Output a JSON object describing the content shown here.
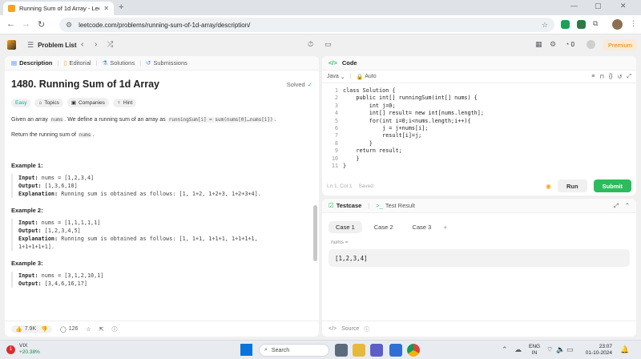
{
  "browser": {
    "tab_title": "Running Sum of 1d Array - Leet",
    "url": "leetcode.com/problems/running-sum-of-1d-array/description/"
  },
  "header": {
    "problem_list": "Problem List",
    "notif_count": "0",
    "premium": "Premium"
  },
  "left": {
    "tabs": [
      "Description",
      "Editorial",
      "Solutions",
      "Submissions"
    ],
    "title": "1480. Running Sum of 1d Array",
    "solved": "Solved",
    "tags": [
      "Easy",
      "Topics",
      "Companies",
      "Hint"
    ],
    "desc1_a": "Given an array ",
    "desc1_code1": "nums",
    "desc1_b": ". We define a running sum of an array as ",
    "desc1_code2": "runningSum[i] = sum(nums[0]…nums[i])",
    "desc1_c": ".",
    "desc2_a": "Return the running sum of ",
    "desc2_code": "nums",
    "desc2_b": ".",
    "examples": [
      {
        "title": "Example 1:",
        "input": "nums = [1,2,3,4]",
        "output": "[1,3,6,10]",
        "explanation": "Running sum is obtained as follows: [1, 1+2, 1+2+3, 1+2+3+4].",
        "explanation2": ""
      },
      {
        "title": "Example 2:",
        "input": "nums = [1,1,1,1,1]",
        "output": "[1,2,3,4,5]",
        "explanation": "Running sum is obtained as follows: [1, 1+1, 1+1+1, 1+1+1+1,",
        "explanation2": "1+1+1+1+1]."
      },
      {
        "title": "Example 3:",
        "input": "nums = [3,1,2,10,1]",
        "output": "[3,4,6,16,17]",
        "explanation": "",
        "explanation2": ""
      }
    ],
    "label_input": "Input:",
    "label_output": "Output:",
    "label_explanation": "Explanation:",
    "likes": "7.9K",
    "comments": "126"
  },
  "code": {
    "title": "Code",
    "language": "Java",
    "auto": "Auto",
    "lines": [
      "class Solution {",
      "    public int[] runningSum(int[] nums) {",
      "        int j=0;",
      "        int[] result= new int[nums.length];",
      "        for(int i=0;i<nums.length;i++){",
      "            j = j+nums[i];",
      "            result[i]=j;",
      "        }",
      "    return result;",
      "    }",
      "}"
    ],
    "line_numbers": [
      "1",
      "2",
      "3",
      "4",
      "5",
      "6",
      "7",
      "8",
      "9",
      "10",
      "11"
    ],
    "status": "Ln 1, Col 1",
    "saved": "Saved",
    "run": "Run",
    "submit": "Submit"
  },
  "testcase": {
    "tab1": "Testcase",
    "tab2": "Test Result",
    "cases": [
      "Case 1",
      "Case 2",
      "Case 3"
    ],
    "add": "+",
    "label": "nums =",
    "value": "[1,2,3,4]",
    "source": "Source"
  },
  "taskbar": {
    "stock": "VIX",
    "stock_change": "+20.38%",
    "search": "Search",
    "lang1": "ENG",
    "lang2": "IN",
    "time": "23:07",
    "date": "01-10-2024"
  }
}
